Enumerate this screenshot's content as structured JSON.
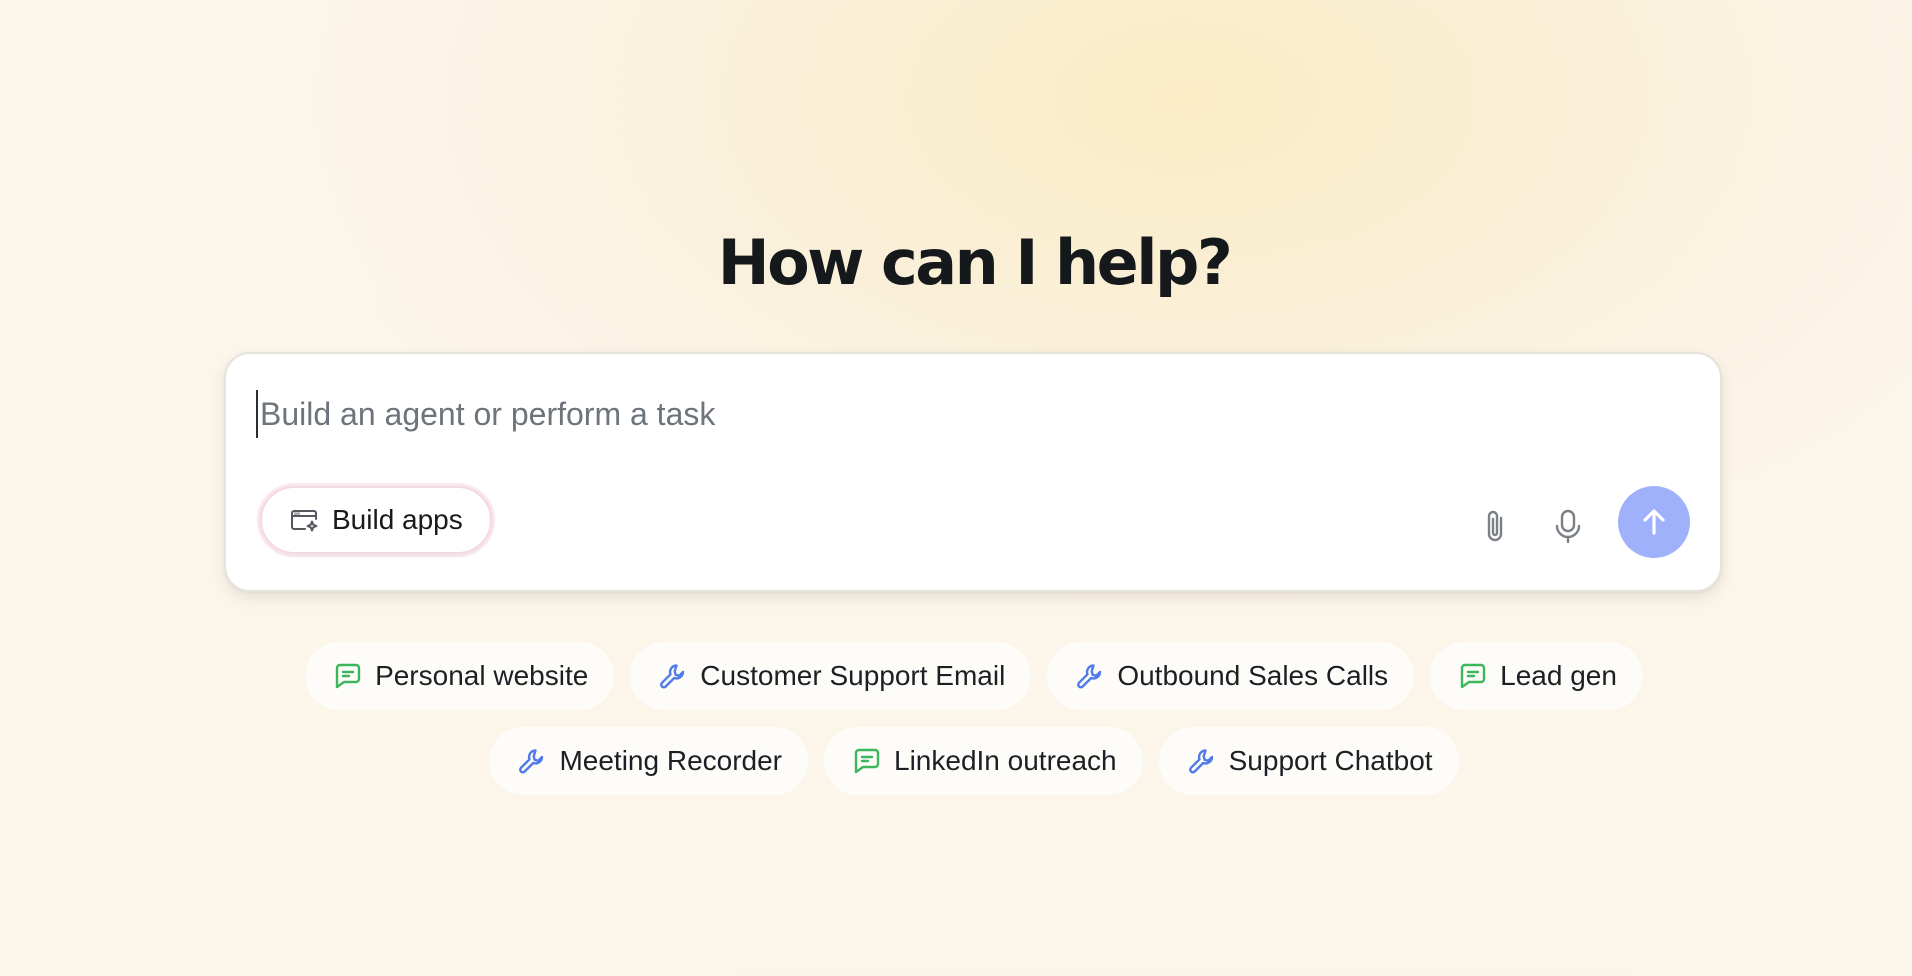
{
  "headline": "How can I help?",
  "composer": {
    "placeholder": "Build an agent or perform a task",
    "value": "",
    "build_apps_label": "Build apps",
    "send_button_color": "#9fb1fb"
  },
  "suggestions": [
    [
      {
        "label": "Personal website",
        "icon": "chat-bubble-icon",
        "icon_color": "#3cb65a"
      },
      {
        "label": "Customer Support Email",
        "icon": "wrench-icon",
        "icon_color": "#4f7be8"
      },
      {
        "label": "Outbound Sales Calls",
        "icon": "wrench-icon",
        "icon_color": "#4f7be8"
      },
      {
        "label": "Lead gen",
        "icon": "chat-bubble-icon",
        "icon_color": "#3cb65a"
      }
    ],
    [
      {
        "label": "Meeting Recorder",
        "icon": "wrench-icon",
        "icon_color": "#4f7be8"
      },
      {
        "label": "LinkedIn outreach",
        "icon": "chat-bubble-icon",
        "icon_color": "#3cb65a"
      },
      {
        "label": "Support Chatbot",
        "icon": "wrench-icon",
        "icon_color": "#4f7be8"
      }
    ]
  ]
}
